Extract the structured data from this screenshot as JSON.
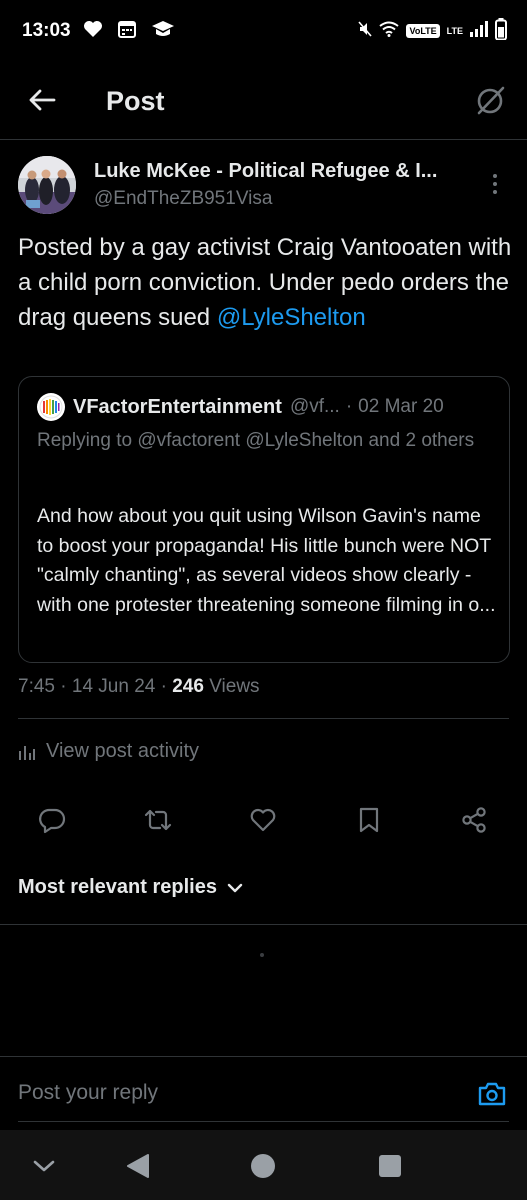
{
  "status_bar": {
    "time": "13:03",
    "volte": "VoLTE",
    "lte": "LTE",
    "icons": [
      "heart-icon",
      "calendar-icon",
      "graduation-cap-icon",
      "mute-icon",
      "wifi-icon",
      "signal-icon",
      "battery-icon"
    ]
  },
  "header": {
    "title": "Post"
  },
  "post": {
    "author_name": "Luke McKee - Political Refugee & I...",
    "author_handle": "@EndTheZB951Visa",
    "text": "Posted by a gay activist Craig Vantooaten with a child porn conviction. Under pedo orders the drag queens sued ",
    "mention": "@LyleShelton",
    "time": "7:45",
    "date": "14 Jun 24",
    "views_count": "246",
    "views_label": "Views",
    "separator": "·"
  },
  "quote": {
    "author_name": "VFactorEntertainment",
    "author_handle": "@vf...",
    "separator": "·",
    "date": "02 Mar 20",
    "replying_to": "Replying to @vfactorent @LyleShelton and 2 others",
    "body": "And how about you quit using Wilson Gavin's name to boost your propaganda! His little bunch were NOT \"calmly chanting\", as several videos show clearly - with one protester threatening someone filming in o..."
  },
  "activity": {
    "label": "View post activity"
  },
  "actions": {
    "icons": [
      "reply-icon",
      "repost-icon",
      "like-icon",
      "bookmark-icon",
      "share-icon"
    ]
  },
  "replies": {
    "sort_label": "Most relevant replies"
  },
  "reply_bar": {
    "placeholder": "Post your reply"
  },
  "colors": {
    "background": "#000000",
    "text": "#e7e9ea",
    "secondary": "#71767b",
    "accent": "#1d9bf0",
    "border": "#2f3336"
  }
}
